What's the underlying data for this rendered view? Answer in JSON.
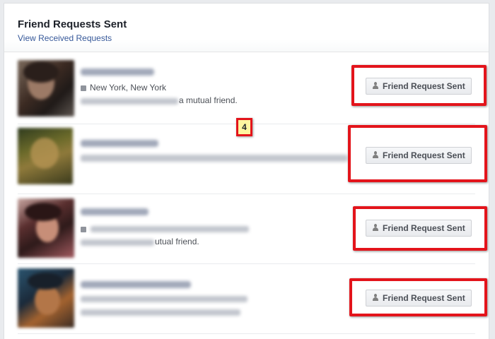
{
  "header": {
    "title": "Friend Requests Sent",
    "link": "View Received Requests"
  },
  "rows": [
    {
      "location": "New York, New York",
      "mutual_text": "a mutual friend.",
      "button": "Friend Request Sent"
    },
    {
      "location": "",
      "mutual_text": "",
      "button": "Friend Request Sent"
    },
    {
      "location": "",
      "mutual_text": "utual friend.",
      "button": "Friend Request Sent"
    },
    {
      "location": "",
      "mutual_text": "",
      "button": "Friend Request Sent"
    }
  ],
  "marker": {
    "label": "4"
  },
  "colors": {
    "annotation": "#e3141b",
    "link": "#365899",
    "marker_bg": "#fff6a0"
  },
  "icons": {
    "location": "location-pin-icon",
    "work": "briefcase-icon",
    "button": "friend-request-icon"
  }
}
